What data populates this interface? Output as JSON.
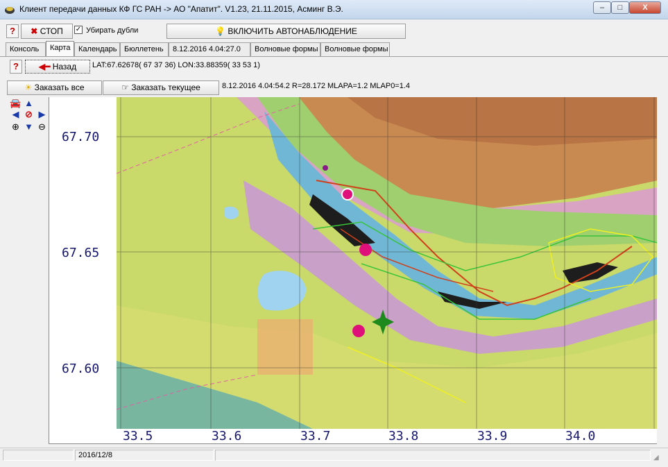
{
  "window": {
    "title": "Клиент передачи данных КФ ГС РАН -> АО \"Апатит\". V1.23, 21.11.2015, Асминг В.Э.",
    "minimize": "–",
    "maximize": "□",
    "close": "X"
  },
  "toolbar": {
    "help_label": "?",
    "stop_label": "СТОП",
    "dedupe_label": "Убирать дубли",
    "dedupe_checked": true,
    "auto_label": "ВКЛЮЧИТЬ АВТОНАБЛЮДЕНИЕ"
  },
  "tabs": [
    {
      "label": "Консоль",
      "active": false
    },
    {
      "label": "Карта",
      "active": true
    },
    {
      "label": "Календарь",
      "active": false
    },
    {
      "label": "Бюллетень",
      "active": false
    },
    {
      "label": "8.12.2016   4.04:27.0",
      "active": false
    },
    {
      "label": "Волновые формы",
      "active": false
    },
    {
      "label": "Волновые формы",
      "active": false
    }
  ],
  "map_toolbar": {
    "help_label": "?",
    "back_label": "Назад",
    "coords": "LAT:67.62678( 67 37 36)  LON:33.88359( 33 53 1)",
    "order_all_label": "Заказать все",
    "order_current_label": "Заказать текущее",
    "event_info": "8.12.2016   4.04:54.2 R=28.172 MLAPA=1.2 MLAP0=1.4"
  },
  "nav_icons": [
    "car-icon",
    "arrow-up-icon",
    "arrow-left-icon",
    "stop-icon",
    "arrow-right-icon",
    "zoom-in-icon",
    "arrow-down-icon",
    "zoom-out-icon"
  ],
  "map": {
    "lat_labels": [
      "67.70",
      "67.65",
      "67.60"
    ],
    "lon_labels": [
      "33.5",
      "33.6",
      "33.7",
      "33.8",
      "33.9",
      "34.0"
    ],
    "colors": {
      "lake": "#9fd3f0",
      "marker": "#e0107a",
      "epicenter": "#1e8a1e",
      "label": "#14146e"
    }
  },
  "statusbar": {
    "cell1": "",
    "cell2": "2016/12/8",
    "cell3": ""
  }
}
